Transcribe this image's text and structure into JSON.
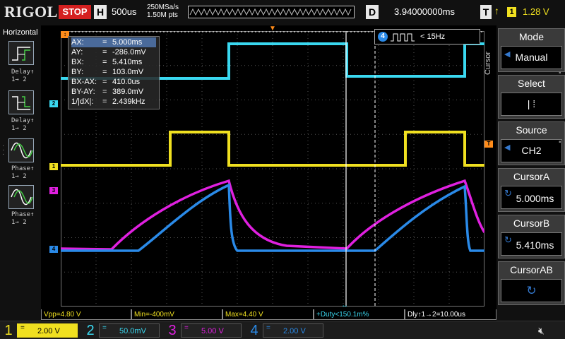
{
  "top": {
    "logo": "RIGOL",
    "run_state": "STOP",
    "h_label": "H",
    "timebase": "500us",
    "sample_rate": "250MSa/s",
    "memory_depth": "1.50M pts",
    "d_label": "D",
    "delay": "3.94000000ms",
    "t_label": "T",
    "trigger_edge": "↑",
    "trigger_channel": "1",
    "trigger_level": "1.28 V"
  },
  "left_panel": {
    "title": "Horizontal",
    "items": [
      {
        "label1": "Delay↑",
        "label2": "1→ 2",
        "icon": "delay-rise-icon"
      },
      {
        "label1": "Delay↑",
        "label2": "1→ 2",
        "icon": "delay-fall-icon"
      },
      {
        "label1": "Phase↑",
        "label2": "1→ 2",
        "icon": "phase-rise-icon"
      },
      {
        "label1": "Phase↑",
        "label2": "1→ 2",
        "icon": "phase-fall-icon"
      }
    ]
  },
  "right_panel": {
    "vertical_label": "Cursor",
    "mode": {
      "title": "Mode",
      "value": "Manual"
    },
    "select": {
      "title": "Select",
      "value": "| ⁞"
    },
    "source": {
      "title": "Source",
      "value": "CH2"
    },
    "cursor_a": {
      "title": "CursorA",
      "value": "5.000ms"
    },
    "cursor_b": {
      "title": "CursorB",
      "value": "5.410ms"
    },
    "cursor_ab": {
      "title": "CursorAB"
    }
  },
  "cursor_readout": {
    "rows": [
      {
        "key": "AX:",
        "value": "5.000ms"
      },
      {
        "key": "AY:",
        "value": "-286.0mV"
      },
      {
        "key": "BX:",
        "value": "5.410ms"
      },
      {
        "key": "BY:",
        "value": "103.0mV"
      },
      {
        "key": "BX-AX:",
        "value": "410.0us"
      },
      {
        "key": "BY-AY:",
        "value": "389.0mV"
      },
      {
        "key": "1/|dX|:",
        "value": "2.439kHz"
      }
    ]
  },
  "frequency": {
    "channel": "4",
    "value": "< 15Hz"
  },
  "markers": {
    "ch1": "1",
    "ch2": "2",
    "ch3": "3",
    "ch4": "4",
    "trig": "T"
  },
  "measurements": [
    {
      "text": "Vpp=4.80 V",
      "color": "#f0e020"
    },
    {
      "text": "Min=-400mV",
      "color": "#f0e020"
    },
    {
      "text": "Max=4.40 V",
      "color": "#f0e020"
    },
    {
      "text": "+Duty<150.1m%",
      "color": "#3ad8f0"
    },
    {
      "text": "Dly↑1→2=10.00us",
      "color": "#ffffff"
    }
  ],
  "channels": [
    {
      "num": "1",
      "coupling": "=",
      "scale": "2.00 V",
      "color": "#f0e020"
    },
    {
      "num": "2",
      "coupling": "=",
      "scale": "50.0mV",
      "color": "#3ad8f0"
    },
    {
      "num": "3",
      "coupling": "=",
      "scale": "5.00 V",
      "color": "#e020e0"
    },
    {
      "num": "4",
      "coupling": "=",
      "scale": "2.00 V",
      "color": "#2a8ae8"
    }
  ],
  "colors": {
    "ch1": "#f0e020",
    "ch2": "#3ad8f0",
    "ch3": "#e020e0",
    "ch4": "#2a8ae8",
    "stop": "#d42020",
    "trigger_marker": "#ff8c1a"
  }
}
